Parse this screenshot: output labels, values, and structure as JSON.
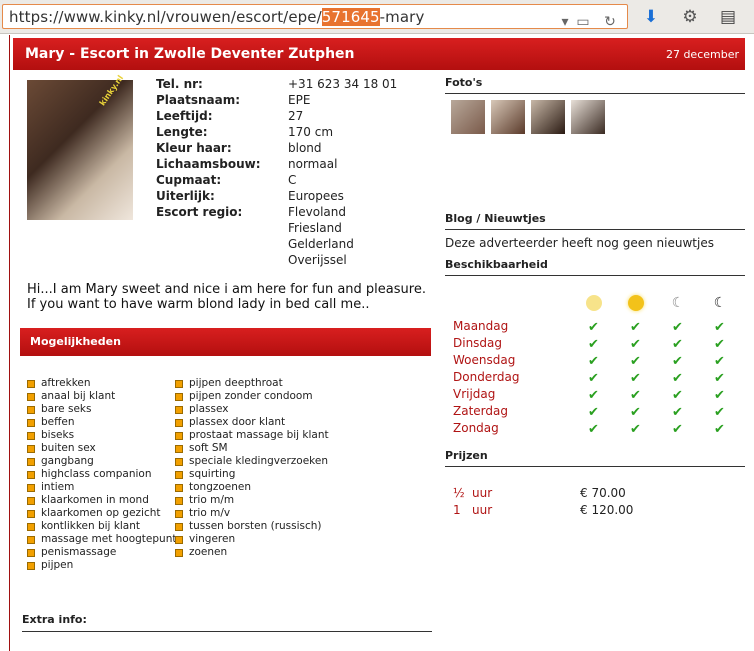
{
  "browser": {
    "url_prefix": "https://www.kinky.nl/vrouwen/escort/epe/",
    "url_highlight": "571645",
    "url_suffix": "-mary"
  },
  "header": {
    "title": "Mary - Escort in Zwolle Deventer Zutphen",
    "date": "27 december"
  },
  "profile": {
    "watermark": "kinky.nl",
    "details": [
      {
        "label": "Tel. nr:",
        "value": "+31 623 34 18 01"
      },
      {
        "label": "Plaatsnaam:",
        "value": "EPE"
      },
      {
        "label": "Leeftijd:",
        "value": "27"
      },
      {
        "label": "Lengte:",
        "value": "170 cm"
      },
      {
        "label": "Kleur haar:",
        "value": "blond"
      },
      {
        "label": "Lichaamsbouw:",
        "value": "normaal"
      },
      {
        "label": "Cupmaat:",
        "value": "C"
      },
      {
        "label": "Uiterlijk:",
        "value": "Europees"
      },
      {
        "label": "Escort regio:",
        "value": "Flevoland"
      },
      {
        "label": "",
        "value": "Friesland"
      },
      {
        "label": "",
        "value": "Gelderland"
      },
      {
        "label": "",
        "value": "Overijssel"
      }
    ],
    "intro_line1": "Hi...I am Mary sweet and nice i am here for fun and pleasure.",
    "intro_line2": "If you want to have warm blond lady in bed call me.."
  },
  "mogelijkheden": {
    "title": "Mogelijkheden",
    "col1": [
      "aftrekken",
      "anaal bij klant",
      "bare seks",
      "beffen",
      "biseks",
      "buiten sex",
      "gangbang",
      "highclass companion",
      "intiem",
      "klaarkomen in mond",
      "klaarkomen op gezicht",
      "kontlikken bij klant",
      "massage met hoogtepunt",
      "penismassage",
      "pijpen"
    ],
    "col2": [
      "pijpen deepthroat",
      "pijpen zonder condoom",
      "plassex",
      "plassex door klant",
      "prostaat massage bij klant",
      "soft SM",
      "speciale kledingverzoeken",
      "squirting",
      "tongzoenen",
      "trio m/m",
      "trio m/v",
      "tussen borsten (russisch)",
      "vingeren",
      "zoenen"
    ]
  },
  "extra": {
    "title": "Extra info:"
  },
  "fotos": {
    "title": "Foto's"
  },
  "blog": {
    "title": "Blog / Nieuwtjes",
    "text": "Deze adverteerder heeft nog geen nieuwtjes"
  },
  "beschikbaarheid": {
    "title": "Beschikbaarheid",
    "icons": [
      "morning-sun-icon",
      "afternoon-sun-icon",
      "evening-moon-icon",
      "night-moon-icon"
    ],
    "days": [
      "Maandag",
      "Dinsdag",
      "Woensdag",
      "Donderdag",
      "Vrijdag",
      "Zaterdag",
      "Zondag"
    ],
    "check": "✔"
  },
  "prijzen": {
    "title": "Prijzen",
    "rows": [
      {
        "qty": "½",
        "unit": "uur",
        "price": "€ 70.00"
      },
      {
        "qty": "1",
        "unit": "uur",
        "price": "€ 120.00"
      }
    ]
  },
  "colors": {
    "accent": "#c41616",
    "bullet": "#f2a000",
    "check": "#2aa020"
  }
}
